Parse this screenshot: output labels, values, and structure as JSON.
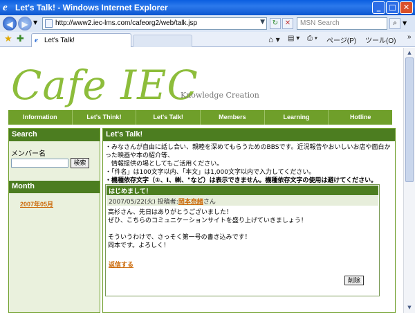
{
  "window": {
    "title": "Let's Talk! - Windows Internet Explorer",
    "min": "_",
    "max": "□",
    "close": "✕"
  },
  "address": {
    "url": "http://www2.iec-lms.com/cafeorg2/web/talk.jsp",
    "search_placeholder": "MSN Search"
  },
  "tab": {
    "label": "Let's Talk!"
  },
  "toolbar": {
    "page": "ページ(P)",
    "tools": "ツール(O)",
    "more": "»"
  },
  "site": {
    "logo": "Cafe IEC",
    "tagline": "Knowledge Creation"
  },
  "nav": {
    "items": [
      "Information",
      "Let's Think!",
      "Let's Talk!",
      "Members",
      "Learning",
      "Hotline"
    ]
  },
  "sidebar": {
    "search_title": "Search",
    "member_label": "メンバー名",
    "search_button": "検索",
    "month_title": "Month",
    "month_link": "2007年05月"
  },
  "main": {
    "title": "Let's Talk!",
    "intro": [
      "・みなさんが自由に話し合い、親睦を深めてもらうためのBBSです。近況報告やおいしいお店や面白かった映画や本の紹介等、",
      "　情報提供の場としてもご活用ください。",
      "・「件名」は100文字以内、「本文」は1,000文字以内で入力してください。",
      "・機種依存文字（①、Ⅰ、㈱、\"など）は表示できません。機種依存文字の使用は避けてください。"
    ]
  },
  "post": {
    "title": "はじめまして！",
    "date": "2007/05/22(火)",
    "author_label": "投稿者:",
    "author": "岡本奈緒",
    "honorific": "さん",
    "body": [
      "高杉さん、先日はありがとうございました！",
      "ぜひ、こちらのコミュニケーションサイトを盛り上げていきましょう！",
      "",
      "そういうわけで、さっそく第一号の書き込みです！",
      "岡本です。よろしく！"
    ],
    "reply": "返信する",
    "delete": "削除"
  }
}
